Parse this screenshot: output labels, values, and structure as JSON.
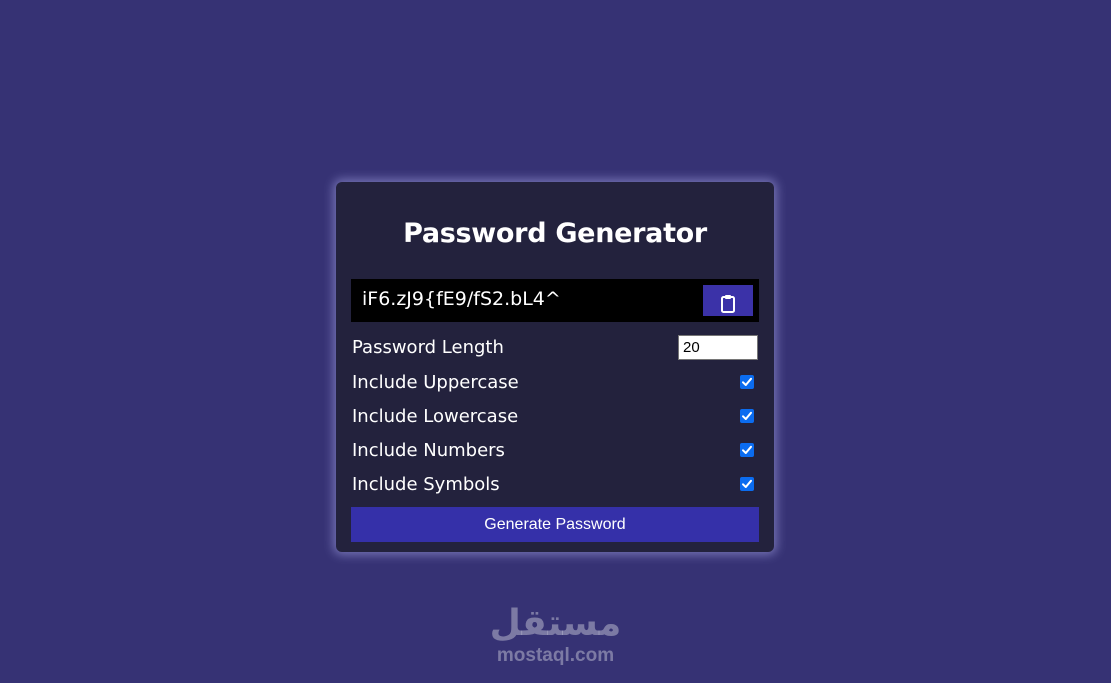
{
  "app": {
    "title": "Password Generator"
  },
  "result": {
    "password": "iF6.zJ9{fE9/fS2.bL4^",
    "copy_icon": "clipboard-icon"
  },
  "settings": {
    "length_label": "Password Length",
    "length_value": "20",
    "options": [
      {
        "label": "Include Uppercase",
        "checked": true
      },
      {
        "label": "Include Lowercase",
        "checked": true
      },
      {
        "label": "Include Numbers",
        "checked": true
      },
      {
        "label": "Include Symbols",
        "checked": true
      }
    ]
  },
  "actions": {
    "generate_label": "Generate Password"
  },
  "watermark": {
    "logo": "مستقل",
    "url": "mostaql.com"
  },
  "colors": {
    "page_background": "#363274",
    "card_background": "#23223d",
    "accent": "#3530a9",
    "checkbox": "#0b6cf0"
  }
}
